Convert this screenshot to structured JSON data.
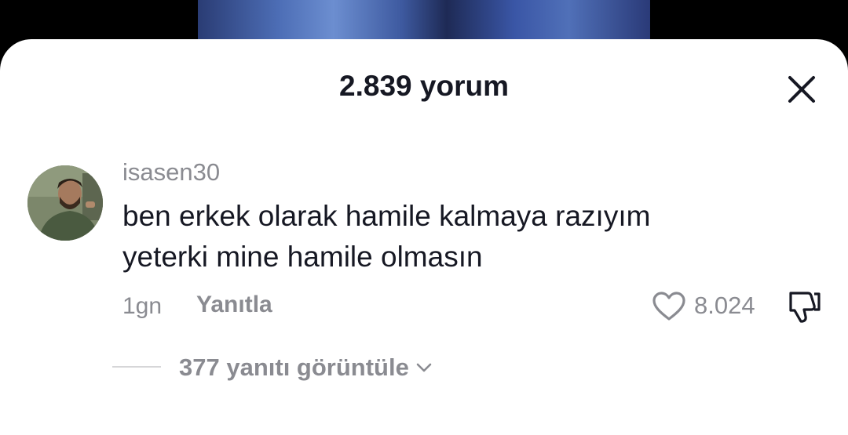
{
  "header": {
    "comment_count_title": "2.839 yorum"
  },
  "comment": {
    "username": "isasen30",
    "text_line1": "ben erkek olarak hamile kalmaya razıyım",
    "text_line2": "yeterki mine hamile olmasın",
    "time": "1gn",
    "reply_label": "Yanıtla",
    "likes": "8.024"
  },
  "replies": {
    "view_label": "377 yanıtı görüntüle"
  },
  "icons": {
    "close": "close-icon",
    "like": "heart-icon",
    "dislike": "thumbs-down-icon",
    "expand": "chevron-down-icon"
  },
  "colors": {
    "primary_text": "#161823",
    "secondary_text": "#8a8b91",
    "sheet_bg": "#ffffff"
  }
}
